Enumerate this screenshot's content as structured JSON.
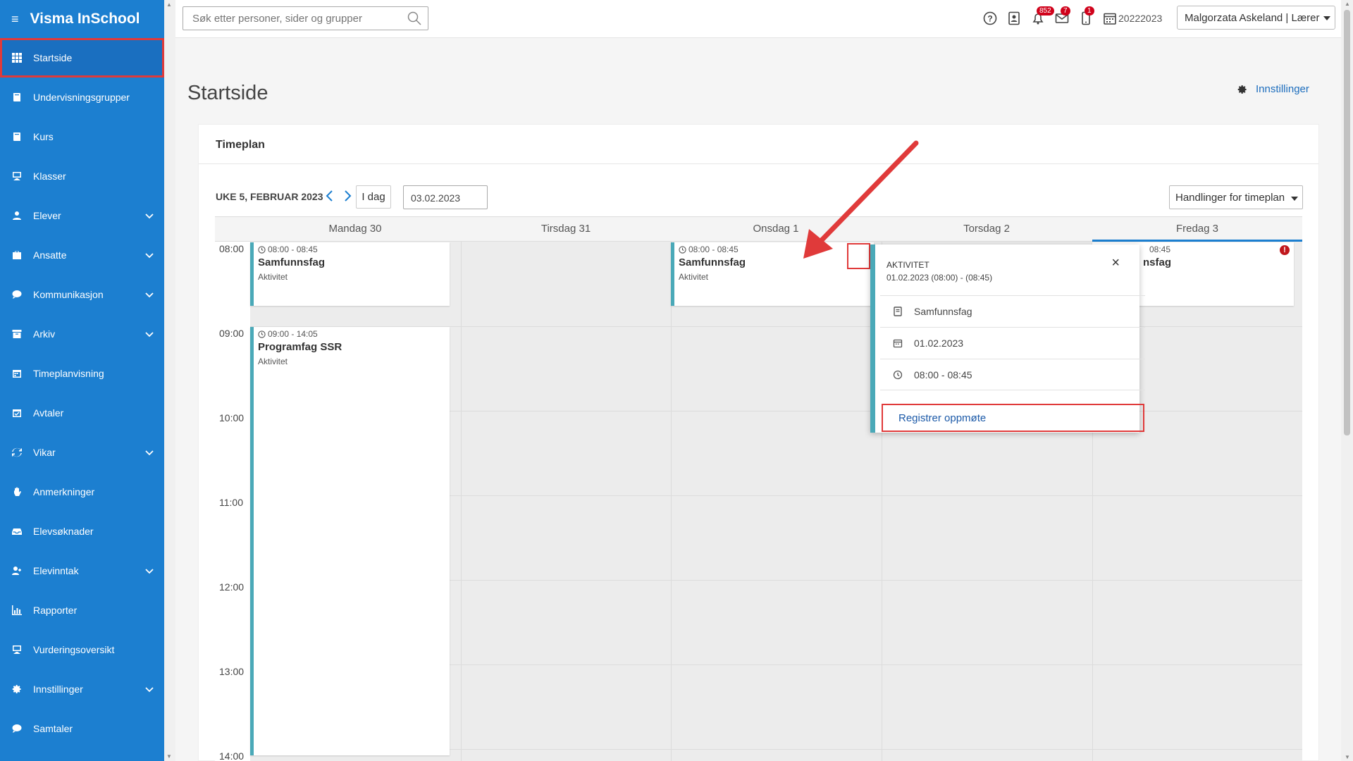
{
  "app": {
    "title": "Visma InSchool"
  },
  "sidebar": {
    "items": [
      {
        "label": "Startside",
        "icon": "grid-icon",
        "expandable": false,
        "active": true
      },
      {
        "label": "Undervisningsgrupper",
        "icon": "book-icon",
        "expandable": false
      },
      {
        "label": "Kurs",
        "icon": "book-icon",
        "expandable": false
      },
      {
        "label": "Klasser",
        "icon": "presentation-icon",
        "expandable": false
      },
      {
        "label": "Elever",
        "icon": "student-icon",
        "expandable": true
      },
      {
        "label": "Ansatte",
        "icon": "briefcase-icon",
        "expandable": true
      },
      {
        "label": "Kommunikasjon",
        "icon": "chat-icon",
        "expandable": true
      },
      {
        "label": "Arkiv",
        "icon": "archive-icon",
        "expandable": true
      },
      {
        "label": "Timeplanvisning",
        "icon": "calendar-icon",
        "expandable": false
      },
      {
        "label": "Avtaler",
        "icon": "calendar-check-icon",
        "expandable": false
      },
      {
        "label": "Vikar",
        "icon": "refresh-icon",
        "expandable": true
      },
      {
        "label": "Anmerkninger",
        "icon": "hand-icon",
        "expandable": false
      },
      {
        "label": "Elevsøknader",
        "icon": "inbox-icon",
        "expandable": false
      },
      {
        "label": "Elevinntak",
        "icon": "user-add-icon",
        "expandable": true
      },
      {
        "label": "Rapporter",
        "icon": "chart-icon",
        "expandable": false
      },
      {
        "label": "Vurderingsoversikt",
        "icon": "presentation-icon",
        "expandable": false
      },
      {
        "label": "Innstillinger",
        "icon": "gear-icon",
        "expandable": true
      },
      {
        "label": "Samtaler",
        "icon": "chat-icon",
        "expandable": false
      }
    ]
  },
  "topbar": {
    "search_placeholder": "Søk etter personer, sider og grupper",
    "notifications_count": "852",
    "messages_count": "7",
    "mobile_count": "1",
    "school_year": "20222023",
    "user": "Malgorzata Askeland | Lærer"
  },
  "page": {
    "title": "Startside",
    "settings_label": "Innstillinger"
  },
  "timeplan": {
    "title": "Timeplan",
    "week_label": "UKE 5, FEBRUAR 2023",
    "today_label": "I dag",
    "date_value": "03.02.2023",
    "actions_label": "Handlinger for timeplan",
    "days": [
      "Mandag 30",
      "Tirsdag 31",
      "Onsdag 1",
      "Torsdag 2",
      "Fredag 3"
    ],
    "times": [
      "08:00",
      "09:00",
      "10:00",
      "11:00",
      "12:00",
      "13:00",
      "14:00"
    ],
    "events": [
      {
        "time": "08:00 - 08:45",
        "name": "Samfunnsfag",
        "sub": "Aktivitet"
      },
      {
        "time": "09:00 - 14:05",
        "name": "Programfag SSR",
        "sub": "Aktivitet"
      },
      {
        "time": "08:00 - 08:45",
        "name": "Samfunnsfag",
        "sub": "Aktivitet"
      },
      {
        "time": "08:45",
        "name": "nsfag"
      }
    ]
  },
  "popup": {
    "type": "AKTIVITET",
    "datetime": "01.02.2023 (08:00) - (08:45)",
    "close": "×",
    "subject": "Samfunnsfag",
    "date": "01.02.2023",
    "time": "08:00 - 08:45",
    "action": "Registrer oppmøte"
  },
  "colors": {
    "sidebar": "#1c7fd0",
    "event_accent": "#4aa9b8",
    "highlight": "#e03a3a",
    "link": "#1c6dbd"
  }
}
